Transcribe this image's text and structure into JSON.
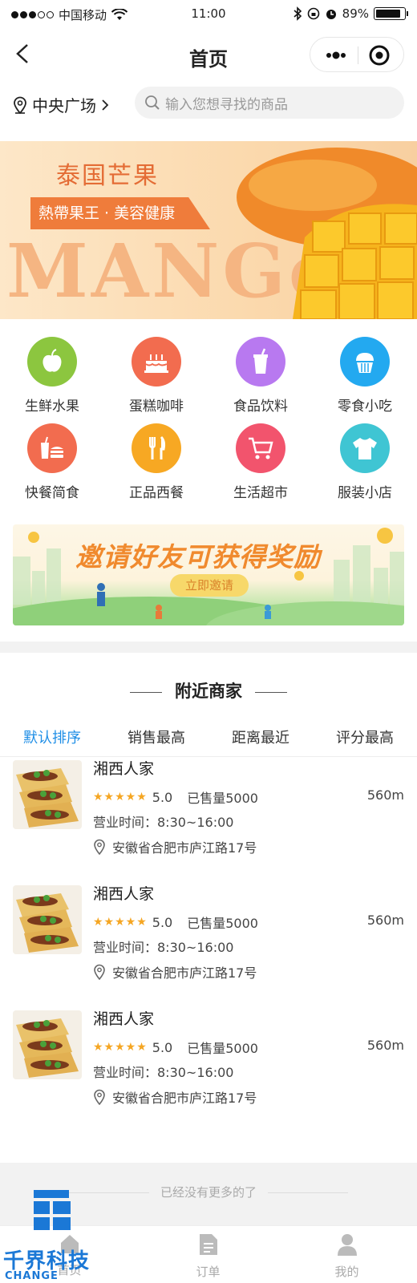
{
  "status_bar": {
    "carrier": "中国移动",
    "time": "11:00",
    "battery": "89%",
    "battery_level": 0.89
  },
  "nav": {
    "title": "首页"
  },
  "location": {
    "label": "中央广场"
  },
  "search": {
    "placeholder": "输入您想寻找的商品"
  },
  "banner": {
    "title": "泰国芒果",
    "tagline": "熱帶果王 · 美容健康",
    "word": "MANGo"
  },
  "categories": [
    {
      "label": "生鲜水果",
      "icon": "apple-icon",
      "color": "#8cc63f"
    },
    {
      "label": "蛋糕咖啡",
      "icon": "cake-icon",
      "color": "#f26c4f"
    },
    {
      "label": "食品饮料",
      "icon": "drink-icon",
      "color": "#b879f0"
    },
    {
      "label": "零食小吃",
      "icon": "cupcake-icon",
      "color": "#23a9f0"
    },
    {
      "label": "快餐简食",
      "icon": "fastfood-icon",
      "color": "#f26c4f"
    },
    {
      "label": "正品西餐",
      "icon": "fork-knife-icon",
      "color": "#f7a823"
    },
    {
      "label": "生活超市",
      "icon": "cart-icon",
      "color": "#f2546d"
    },
    {
      "label": "服装小店",
      "icon": "tshirt-icon",
      "color": "#3fc5d3"
    }
  ],
  "invite": {
    "text": "邀请好友可获得奖励",
    "button": "立即邀请"
  },
  "nearby": {
    "title": "附近商家",
    "sort_tabs": [
      "默认排序",
      "销售最高",
      "距离最近",
      "评分最高"
    ],
    "active_sort": 0,
    "accent": "#1f8ee6",
    "shops": [
      {
        "name": "湘西人家",
        "stars": "★★★★★",
        "rating": "5.0",
        "sold": "已售量5000",
        "distance": "560m",
        "hours": "营业时间：8:30~16:00",
        "address": "安徽省合肥市庐江路17号"
      },
      {
        "name": "湘西人家",
        "stars": "★★★★★",
        "rating": "5.0",
        "sold": "已售量5000",
        "distance": "560m",
        "hours": "营业时间：8:30~16:00",
        "address": "安徽省合肥市庐江路17号"
      },
      {
        "name": "湘西人家",
        "stars": "★★★★★",
        "rating": "5.0",
        "sold": "已售量5000",
        "distance": "560m",
        "hours": "营业时间：8:30~16:00",
        "address": "安徽省合肥市庐江路17号"
      }
    ]
  },
  "footer": {
    "no_more": "已经没有更多的了"
  },
  "tabbar": {
    "tabs": [
      {
        "label": "首页",
        "icon": "home-icon"
      },
      {
        "label": "订单",
        "icon": "order-icon"
      },
      {
        "label": "我的",
        "icon": "user-icon"
      }
    ]
  },
  "watermark": {
    "text": "千界科技",
    "sub": "CHANGE"
  }
}
